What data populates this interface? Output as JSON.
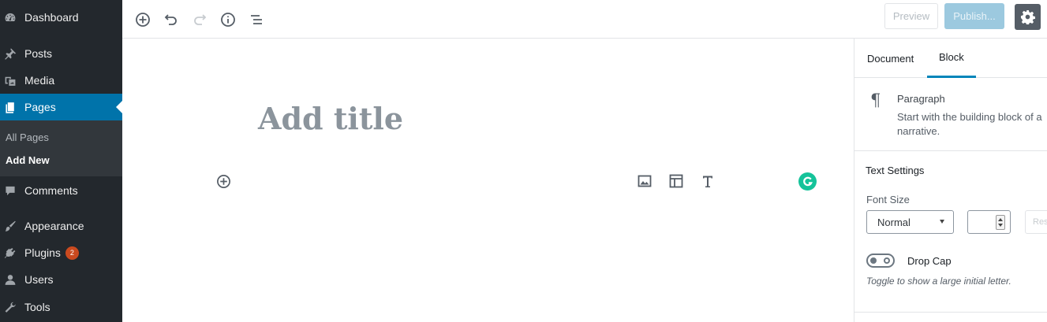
{
  "admin_menu": {
    "items": [
      {
        "label": "Dashboard",
        "icon": "dashboard-icon"
      },
      {
        "label": "Posts",
        "icon": "pin-icon"
      },
      {
        "label": "Media",
        "icon": "media-icon"
      },
      {
        "label": "Pages",
        "icon": "pages-icon",
        "active": true
      },
      {
        "label": "Comments",
        "icon": "comment-icon"
      },
      {
        "label": "Appearance",
        "icon": "paintbrush-icon"
      },
      {
        "label": "Plugins",
        "icon": "plugin-icon",
        "badge": "2"
      },
      {
        "label": "Users",
        "icon": "user-icon"
      },
      {
        "label": "Tools",
        "icon": "wrench-icon"
      }
    ],
    "submenu": [
      {
        "label": "All Pages"
      },
      {
        "label": "Add New",
        "current": true
      }
    ],
    "colors": {
      "background": "#23282d",
      "active": "#0073aa",
      "submenu": "#32373c",
      "badge": "#ca4a1f"
    }
  },
  "toolbar": {
    "icons": [
      "add-block-icon",
      "undo-icon",
      "redo-icon",
      "info-icon",
      "outline-icon"
    ],
    "preview_label": "Preview",
    "publish_label": "Publish...",
    "settings_icon": "gear-icon"
  },
  "editor": {
    "title_placeholder": "Add title",
    "quick_inserter_icons": [
      "image-icon",
      "gallery-icon",
      "heading-icon"
    ],
    "extension_icon": "grammarly-icon"
  },
  "settings_panel": {
    "tabs": [
      {
        "label": "Document",
        "active": false
      },
      {
        "label": "Block",
        "active": true
      }
    ],
    "block": {
      "icon": "paragraph-icon",
      "name": "Paragraph",
      "description_line1": "Start with the building block of a",
      "description_line2": "narrative."
    },
    "text_settings": {
      "title": "Text Settings",
      "font_size_label": "Font Size",
      "font_size_value": "Normal",
      "custom_size_value": "",
      "reset_label": "Reset",
      "drop_cap_label": "Drop Cap",
      "drop_cap_enabled": false,
      "drop_cap_help": "Toggle to show a large initial letter."
    },
    "accent_color": "#0085ba"
  }
}
